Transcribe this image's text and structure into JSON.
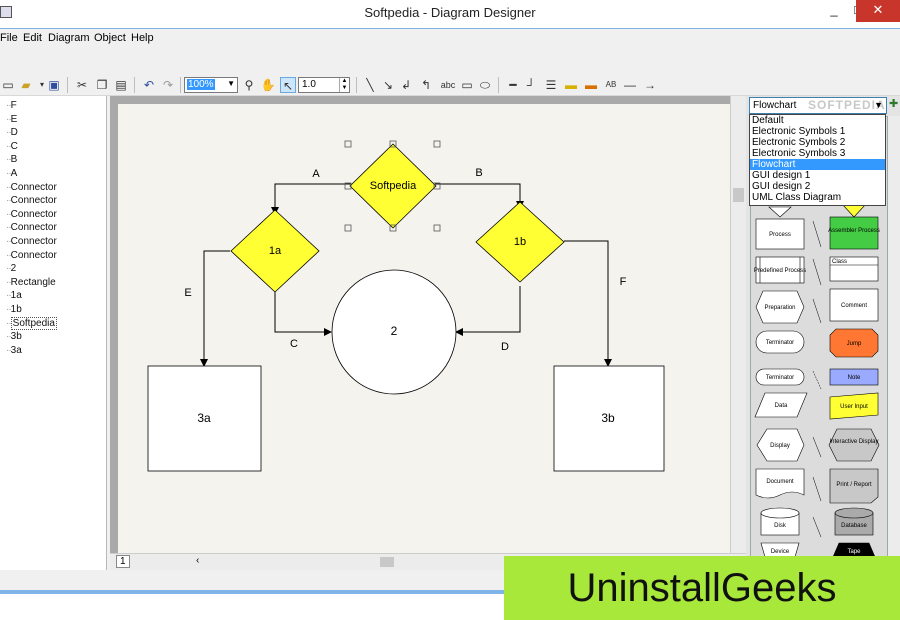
{
  "window": {
    "title": "Softpedia - Diagram Designer",
    "minimize_glyph": "_",
    "maximize_glyph": "□",
    "close_glyph": "✕"
  },
  "menu": [
    "File",
    "Edit",
    "Diagram",
    "Object",
    "Help"
  ],
  "toolbar": {
    "zoom": "100%",
    "line_width": "1.0",
    "text_tool_label": "abc",
    "icons": [
      "new-icon",
      "open-icon",
      "save-icon",
      "cut-icon",
      "copy-icon",
      "paste-icon",
      "undo-icon",
      "redo-icon",
      "zoom-icon",
      "pan-icon",
      "select-icon",
      "line-icon",
      "arrow-line-icon",
      "connector-icon",
      "curve-icon",
      "text-icon",
      "rectangle-icon",
      "ellipse-icon",
      "line-style-icon",
      "fill-color-icon",
      "align-icon",
      "font-size-icon",
      "arrow-end-icon"
    ]
  },
  "tree": [
    "F",
    "E",
    "D",
    "C",
    "B",
    "A",
    "Connector",
    "Connector",
    "Connector",
    "Connector",
    "Connector",
    "Connector",
    "2",
    "Rectangle",
    "1a",
    "1b",
    "Softpedia",
    "3b",
    "3a"
  ],
  "tree_selected": "Softpedia",
  "diagram": {
    "top_diamond": "Softpedia",
    "left_diamond": "1a",
    "right_diamond": "1b",
    "circle": "2",
    "left_box": "3a",
    "right_box": "3b",
    "label_a": "A",
    "label_b": "B",
    "label_c": "C",
    "label_d": "D",
    "label_e": "E",
    "label_f": "F"
  },
  "page_tab": "1",
  "library": {
    "selected": "Flowchart",
    "options": [
      "Default",
      "Electronic Symbols 1",
      "Electronic Symbols 2",
      "Electronic Symbols 3",
      "Flowchart",
      "GUI design 1",
      "GUI design 2",
      "UML Class Diagram"
    ],
    "watermark_text": "SOFTPEDIA"
  },
  "shapes": {
    "process": "Process",
    "assembler": "Assembler Process",
    "predefined": "Predefined Process",
    "class": "Class",
    "preparation": "Preparation",
    "comment": "Comment",
    "terminator1": "Terminator",
    "jump": "Jump",
    "terminator2": "Terminator",
    "note": "Note",
    "data": "Data",
    "user_input": "User Input",
    "display": "Display",
    "interactive_display": "Interactive Display",
    "document": "Document",
    "print_report": "Print / Report",
    "disk": "Disk",
    "database": "Database",
    "device": "Device",
    "tape": "Tape"
  },
  "overlay_brand": "UninstallGeeks",
  "colors": {
    "diamond_fill": "#ffff33",
    "assembler_fill": "#44cc44",
    "jump_fill": "#ff7733",
    "note_fill": "#99aaff",
    "user_input_fill": "#ffff33",
    "watermark_bg": "#a7e83a",
    "selection": "#3399ff"
  }
}
